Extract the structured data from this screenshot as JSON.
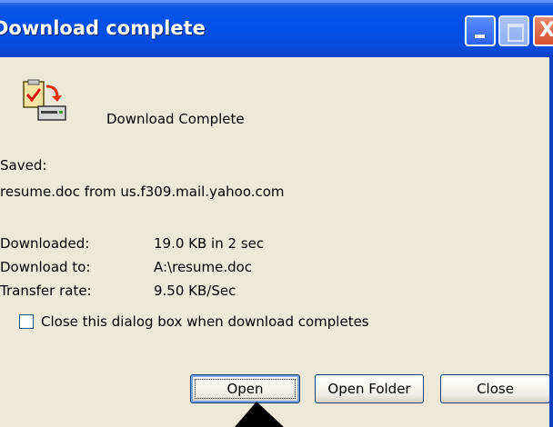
{
  "window": {
    "title": "Download complete"
  },
  "titlebar_buttons": {
    "minimize_icon": "minimize-icon",
    "maximize_icon": "maximize-icon",
    "close_glyph": "X"
  },
  "header": {
    "message": "Download Complete",
    "icon": "download-complete-icon"
  },
  "saved": {
    "label": "Saved:",
    "detail": "resume.doc from us.f309.mail.yahoo.com"
  },
  "details": [
    {
      "label": "Downloaded:",
      "value": "19.0 KB in 2 sec"
    },
    {
      "label": "Download to:",
      "value": "A:\\resume.doc"
    },
    {
      "label": "Transfer rate:",
      "value": "9.50 KB/Sec"
    }
  ],
  "close_checkbox": {
    "label": "Close this dialog box when download completes",
    "checked": false
  },
  "buttons": {
    "open": "Open",
    "open_folder": "Open Folder",
    "close": "Close"
  },
  "colors": {
    "title_bar": "#0050ea",
    "dialog_bg": "#ece9d8",
    "close_button": "#d5512e"
  }
}
